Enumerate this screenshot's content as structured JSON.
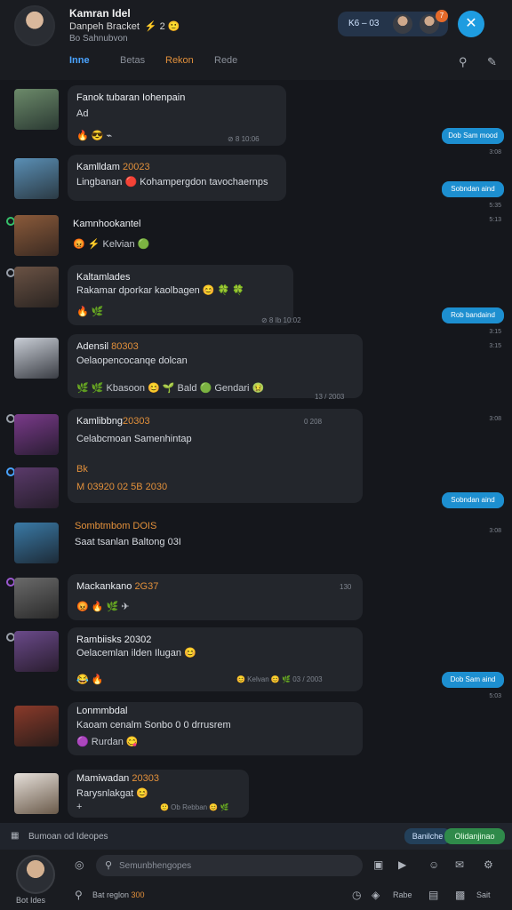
{
  "header": {
    "name": "Kamran Idel",
    "subtitle": "Danpeh Bracket",
    "subtitle_emoji": "⚡ 2 🙂",
    "meta": "Bo Sahnubvon",
    "pill_text": "K6 – 03",
    "pill_badge": "7",
    "fab_icon": "✕",
    "tabs": [
      "Inne",
      "Betas",
      "Rekon",
      "Rede"
    ],
    "search_icon": "search-icon",
    "compose_icon": "compose-icon"
  },
  "messages": [
    {
      "title": "Fanok tubaran Iohenpain",
      "title_num": "",
      "text": "Ad",
      "react": "🔥 😎 ⌁",
      "meta": "⊘ 8 10:06",
      "side_label": "Dob Sam mood",
      "side_time": "3:08"
    },
    {
      "title": "Kamlldam",
      "title_num": "20023",
      "text": "Lingbanan 🔴 Kohampergdon tavochaernps",
      "react": "",
      "meta": "",
      "side_label": "Sobndan aind",
      "side_time": "5:35"
    },
    {
      "title": "Kamnhookantel",
      "title_num": "",
      "text": "",
      "react": "😡 ⚡ Kelvian 🟢",
      "meta": "",
      "side_label": "",
      "side_time": "5:13"
    },
    {
      "title": "Kaltamlades",
      "title_num": "",
      "text": "Rakamar dporkar kaolbagen 😊 🍀 🍀",
      "react": "🔥 🌿",
      "meta": "⊘ 8 Ib 10:02",
      "side_label": "Rob bandaind",
      "side_time": "3:15"
    },
    {
      "title": "Adensil",
      "title_num": "80303",
      "text": "Oelaopencocanqe dolcan",
      "react": "🌿 🌿 Kbasoon 😊 🌱 Bald 🟢 Gendari 🤢",
      "meta": "13 / 2003",
      "side_label": "",
      "side_time": "3:15"
    },
    {
      "title": "Kamlibbng",
      "title_num": "20303",
      "text": "Celabcmoan Samenhintap",
      "react": "",
      "meta": "0  208",
      "side_label": "",
      "side_time": "3:08"
    },
    {
      "title": "",
      "title_num": "",
      "text": "Bk",
      "react": "M 03920 02 5B 2030",
      "meta": "",
      "side_label": "Sobndan aind",
      "side_time": "3:03"
    },
    {
      "title": "Sombtmbom",
      "title_num": "DOIS",
      "text": "Saat tsanlan Baltong 03I",
      "react": "",
      "meta": "",
      "side_label": "",
      "side_time": "3:08"
    },
    {
      "title": "Mackankano",
      "title_num": "2G37",
      "text": "",
      "react": "😡 🔥 🌿 ✈",
      "meta": "130",
      "side_label": "",
      "side_time": ""
    },
    {
      "title": "Rambiisks",
      "title_num": "20302",
      "text": "Oelacemlan ilden Ilugan 😊",
      "react": "😂 🔥",
      "meta": "😊 Kelvan 😊 🌿 03 / 2003",
      "side_label": "Dob Sam aind",
      "side_time": "5:03"
    },
    {
      "title": "Lonmmbdal",
      "title_num": "",
      "text": "Kaoam cenalm Sonbo 0 0 drrusrem",
      "react": "🟣 Rurdan 😋",
      "meta": "",
      "side_label": "",
      "side_time": ""
    },
    {
      "title": "Mamiwadan",
      "title_num": "20303",
      "text": "Rarysnlakgat 😊",
      "react": "+",
      "meta": "🙂 Ob Rebban 😊 🌿",
      "side_label": "",
      "side_time": ""
    }
  ],
  "composer": {
    "icon": "calendar-icon",
    "text": "Bumoan od Ideopes",
    "btn1": "Banilche",
    "btn2": "Olidanjinao"
  },
  "bottom": {
    "my_name": "Bot Ides",
    "search_placeholder": "Semunbhengopes",
    "quick_label": "Bat reglon",
    "quick_num": "300",
    "labels": [
      "Rabe",
      "Sait"
    ]
  }
}
